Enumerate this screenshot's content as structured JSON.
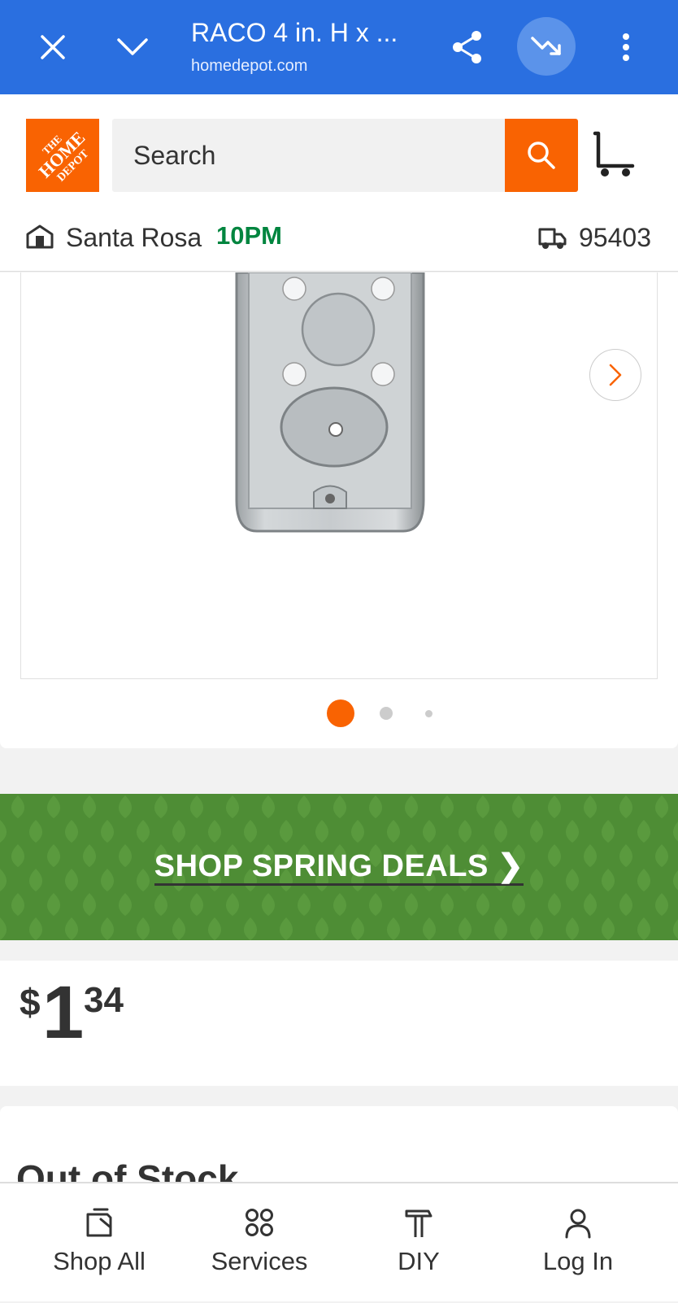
{
  "browser": {
    "title": "RACO 4 in. H x ...",
    "url": "homedepot.com",
    "accent_color": "#2a6fe0",
    "icons": [
      "close-icon",
      "chevron-down-icon",
      "share-icon",
      "trending-down-icon",
      "more-vert-icon"
    ]
  },
  "header": {
    "logo_text": [
      "THE",
      "HOME",
      "DEPOT"
    ],
    "search_placeholder": "Search",
    "brand_color": "#f96302",
    "store_name": "Santa Rosa",
    "store_hours": "10PM",
    "zip_code": "95403"
  },
  "gallery": {
    "dot_count": 3,
    "active_dot": 0
  },
  "promo": {
    "text": "SHOP SPRING DEALS ❯",
    "color": "#4e8d35"
  },
  "price": {
    "dollar_sign": "$",
    "whole": "1",
    "cents": "34"
  },
  "stock": {
    "title": "Out of Stock"
  },
  "bottom_nav": {
    "items": [
      {
        "label": "Shop All",
        "icon": "tag-icon"
      },
      {
        "label": "Services",
        "icon": "grid-icon"
      },
      {
        "label": "DIY",
        "icon": "hammer-icon"
      },
      {
        "label": "Log In",
        "icon": "user-icon"
      }
    ]
  }
}
